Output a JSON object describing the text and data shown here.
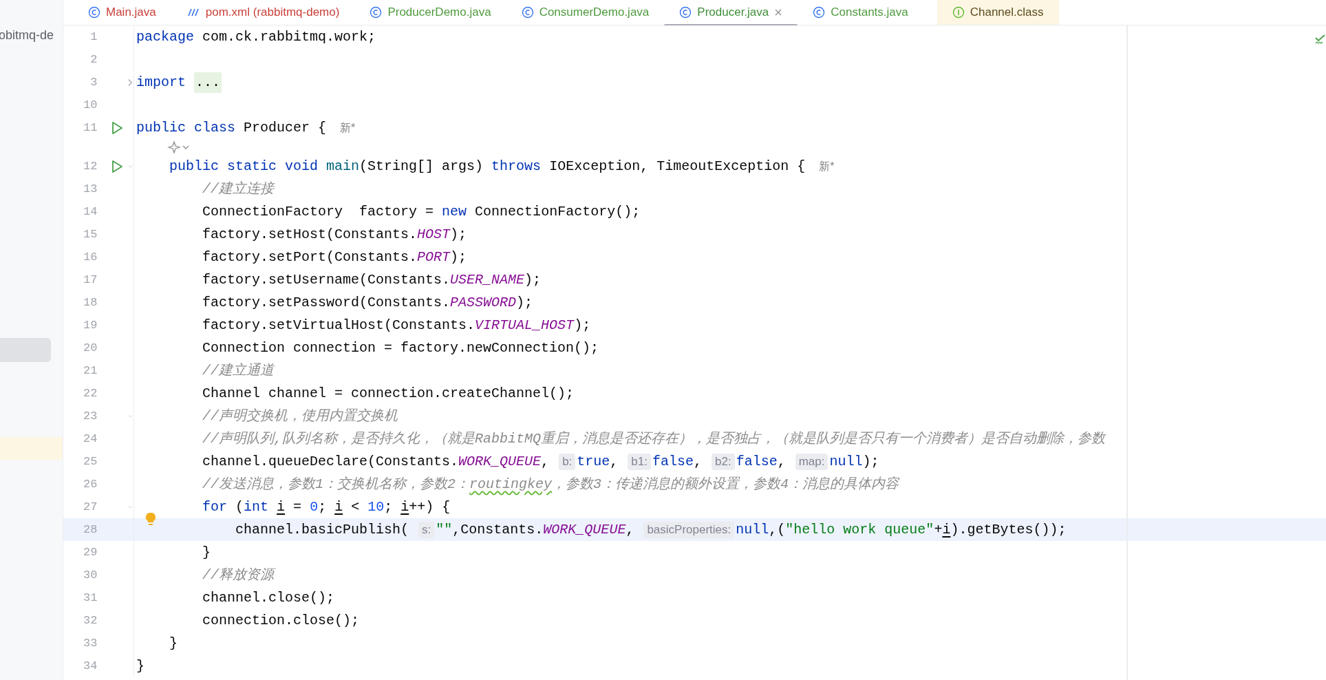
{
  "project_panel": {
    "label": "obitmq-de"
  },
  "tabs": [
    {
      "label": "Main.java",
      "kind": "class",
      "color": "#c9403a",
      "selected": false
    },
    {
      "label": "pom.xml (rabbitmq-demo)",
      "kind": "maven",
      "color": "#c9403a",
      "selected": false
    },
    {
      "label": "ProducerDemo.java",
      "kind": "class",
      "color": "#4f9a3f",
      "selected": false
    },
    {
      "label": "ConsumerDemo.java",
      "kind": "class",
      "color": "#4f9a3f",
      "selected": false
    },
    {
      "label": "Producer.java",
      "kind": "class",
      "color": "#3f8f3a",
      "selected": true
    },
    {
      "label": "Constants.java",
      "kind": "class",
      "color": "#4f9a3f",
      "selected": false
    },
    {
      "label": "Channel.class",
      "kind": "interface",
      "color": "#5c4a1e",
      "selected": false
    }
  ],
  "editor": {
    "lines": [
      {
        "kind": "code",
        "number": "1",
        "tokens": [
          {
            "kind": "keyword",
            "text": "package"
          },
          {
            "kind": "plain",
            "text": " com.ck.rabbitmq.work;"
          }
        ]
      },
      {
        "kind": "code",
        "number": "2"
      },
      {
        "kind": "code",
        "number": "3",
        "collapsed": true,
        "tokens": [
          {
            "kind": "keyword",
            "text": "import "
          },
          {
            "kind": "folded",
            "text": "..."
          }
        ]
      },
      {
        "kind": "code",
        "number": "10"
      },
      {
        "kind": "code",
        "number": "11",
        "run": true,
        "tokens": [
          {
            "kind": "keyword",
            "text": "public class"
          },
          {
            "kind": "plain",
            "text": " Producer { "
          },
          {
            "kind": "author",
            "text": "新*"
          }
        ]
      },
      {
        "kind": "inlay"
      },
      {
        "kind": "code",
        "number": "12",
        "run": true,
        "collapsed": false,
        "tokens": [
          {
            "kind": "keyword",
            "text": "    public static void "
          },
          {
            "kind": "method",
            "text": "main"
          },
          {
            "kind": "plain",
            "text": "(String[] args) "
          },
          {
            "kind": "keyword",
            "text": "throws"
          },
          {
            "kind": "plain",
            "text": " IOException, TimeoutException { "
          },
          {
            "kind": "author",
            "text": "新*"
          }
        ]
      },
      {
        "kind": "code",
        "number": "13",
        "tokens": [
          {
            "kind": "comment",
            "text": "        //建立连接"
          }
        ]
      },
      {
        "kind": "code",
        "number": "14",
        "tokens": [
          {
            "kind": "plain",
            "text": "        ConnectionFactory  factory = "
          },
          {
            "kind": "keyword",
            "text": "new"
          },
          {
            "kind": "plain",
            "text": " ConnectionFactory();"
          }
        ]
      },
      {
        "kind": "code",
        "number": "15",
        "tokens": [
          {
            "kind": "plain",
            "text": "        factory.setHost(Constants."
          },
          {
            "kind": "constant",
            "text": "HOST"
          },
          {
            "kind": "plain",
            "text": ");"
          }
        ]
      },
      {
        "kind": "code",
        "number": "16",
        "tokens": [
          {
            "kind": "plain",
            "text": "        factory.setPort(Constants."
          },
          {
            "kind": "constant",
            "text": "PORT"
          },
          {
            "kind": "plain",
            "text": ");"
          }
        ]
      },
      {
        "kind": "code",
        "number": "17",
        "tokens": [
          {
            "kind": "plain",
            "text": "        factory.setUsername(Constants."
          },
          {
            "kind": "constant",
            "text": "USER_NAME"
          },
          {
            "kind": "plain",
            "text": ");"
          }
        ]
      },
      {
        "kind": "code",
        "number": "18",
        "tokens": [
          {
            "kind": "plain",
            "text": "        factory.setPassword(Constants."
          },
          {
            "kind": "constant",
            "text": "PASSWORD"
          },
          {
            "kind": "plain",
            "text": ");"
          }
        ]
      },
      {
        "kind": "code",
        "number": "19",
        "tokens": [
          {
            "kind": "plain",
            "text": "        factory.setVirtualHost(Constants."
          },
          {
            "kind": "constant",
            "text": "VIRTUAL_HOST"
          },
          {
            "kind": "plain",
            "text": ");"
          }
        ]
      },
      {
        "kind": "code",
        "number": "20",
        "tokens": [
          {
            "kind": "plain",
            "text": "        Connection connection = factory.newConnection();"
          }
        ]
      },
      {
        "kind": "code",
        "number": "21",
        "tokens": [
          {
            "kind": "comment",
            "text": "        //建立通道"
          }
        ]
      },
      {
        "kind": "code",
        "number": "22",
        "tokens": [
          {
            "kind": "plain",
            "text": "        Channel channel = connection.createChannel();"
          }
        ]
      },
      {
        "kind": "code",
        "number": "23",
        "collapsed": false,
        "tokens": [
          {
            "kind": "comment",
            "text": "        //声明交换机，使用内置交换机"
          }
        ]
      },
      {
        "kind": "code",
        "number": "24",
        "tokens": [
          {
            "kind": "comment",
            "text": "        //声明队列,队列名称，是否持久化，（就是RabbitMQ重启，消息是否还存在），是否独占，（就是队列是否只有一个消费者）是否自动删除，参数"
          }
        ]
      },
      {
        "kind": "code",
        "number": "25",
        "tokens": [
          {
            "kind": "plain",
            "text": "        channel.queueDeclare(Constants."
          },
          {
            "kind": "constant",
            "text": "WORK_QUEUE"
          },
          {
            "kind": "plain",
            "text": ", "
          },
          {
            "kind": "hint",
            "text": "b:"
          },
          {
            "kind": "keyword",
            "text": "true"
          },
          {
            "kind": "plain",
            "text": ", "
          },
          {
            "kind": "hint",
            "text": "b1:"
          },
          {
            "kind": "keyword",
            "text": "false"
          },
          {
            "kind": "plain",
            "text": ", "
          },
          {
            "kind": "hint",
            "text": "b2:"
          },
          {
            "kind": "keyword",
            "text": "false"
          },
          {
            "kind": "plain",
            "text": ", "
          },
          {
            "kind": "hint",
            "text": "map:"
          },
          {
            "kind": "keyword",
            "text": "null"
          },
          {
            "kind": "plain",
            "text": ");"
          }
        ]
      },
      {
        "kind": "code",
        "number": "26",
        "tokens": [
          {
            "kind": "comment",
            "text": "        //发送消息，参数1：交换机名称，参数2："
          },
          {
            "kind": "typo",
            "text": "routingkey"
          },
          {
            "kind": "comment",
            "text": "，参数3：传递消息的额外设置，参数4：消息的具体内容"
          }
        ]
      },
      {
        "kind": "code",
        "number": "27",
        "collapsed": false,
        "tokens": [
          {
            "kind": "keyword",
            "text": "        for"
          },
          {
            "kind": "plain",
            "text": " ("
          },
          {
            "kind": "keyword",
            "text": "int "
          },
          {
            "kind": "var",
            "text": "i"
          },
          {
            "kind": "plain",
            "text": " = "
          },
          {
            "kind": "number",
            "text": "0"
          },
          {
            "kind": "plain",
            "text": "; "
          },
          {
            "kind": "var",
            "text": "i"
          },
          {
            "kind": "plain",
            "text": " < "
          },
          {
            "kind": "number",
            "text": "10"
          },
          {
            "kind": "plain",
            "text": "; "
          },
          {
            "kind": "var",
            "text": "i"
          },
          {
            "kind": "plain",
            "text": "++) {"
          }
        ]
      },
      {
        "kind": "code",
        "number": "28",
        "bulb": true,
        "selected": true,
        "tokens": [
          {
            "kind": "plain",
            "text": "            channel.basicPublish( "
          },
          {
            "kind": "hint",
            "text": "s:"
          },
          {
            "kind": "string",
            "text": "\"\""
          },
          {
            "kind": "plain",
            "text": ",Constants."
          },
          {
            "kind": "constant",
            "text": "WORK_QUEUE"
          },
          {
            "kind": "plain",
            "text": ", "
          },
          {
            "kind": "hint",
            "text": "basicProperties:"
          },
          {
            "kind": "keyword",
            "text": "null"
          },
          {
            "kind": "plain",
            "text": ",("
          },
          {
            "kind": "string",
            "text": "\"hello work queue\""
          },
          {
            "kind": "plain",
            "text": "+"
          },
          {
            "kind": "var",
            "text": "i"
          },
          {
            "kind": "plain",
            "text": ").getBytes());"
          }
        ]
      },
      {
        "kind": "code",
        "number": "29",
        "tokens": [
          {
            "kind": "plain",
            "text": "        }"
          }
        ]
      },
      {
        "kind": "code",
        "number": "30",
        "tokens": [
          {
            "kind": "comment",
            "text": "        //释放资源"
          }
        ]
      },
      {
        "kind": "code",
        "number": "31",
        "tokens": [
          {
            "kind": "plain",
            "text": "        channel.close();"
          }
        ]
      },
      {
        "kind": "code",
        "number": "32",
        "tokens": [
          {
            "kind": "plain",
            "text": "        connection.close();"
          }
        ]
      },
      {
        "kind": "code",
        "number": "33",
        "tokens": [
          {
            "kind": "plain",
            "text": "    }"
          }
        ]
      },
      {
        "kind": "code",
        "number": "34",
        "tokens": [
          {
            "kind": "plain",
            "text": "}"
          }
        ]
      }
    ]
  }
}
